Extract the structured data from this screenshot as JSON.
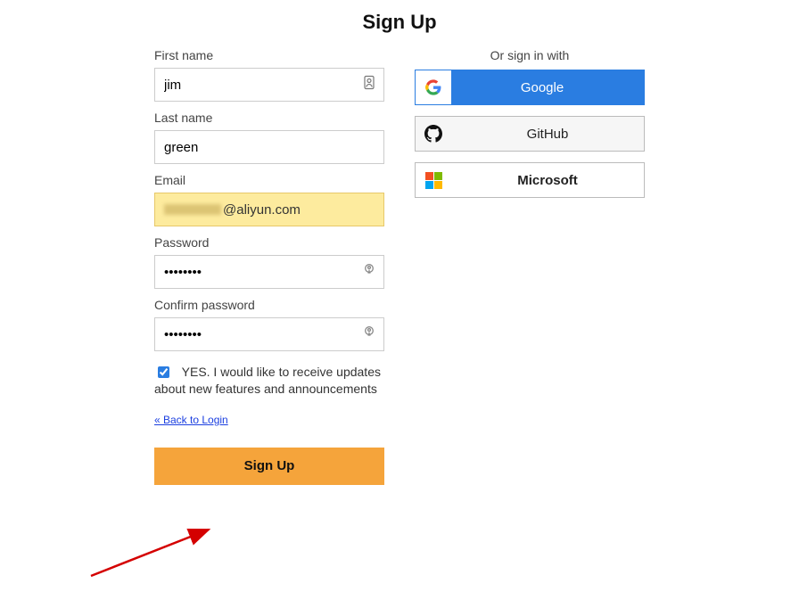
{
  "title": "Sign Up",
  "form": {
    "first_name": {
      "label": "First name",
      "value": "jim"
    },
    "last_name": {
      "label": "Last name",
      "value": "green"
    },
    "email": {
      "label": "Email",
      "value_suffix": "@aliyun.com"
    },
    "password": {
      "label": "Password",
      "value": "••••••••"
    },
    "confirm": {
      "label": "Confirm password",
      "value": "••••••••"
    },
    "updates": {
      "checked": true,
      "text": "YES. I would like to receive updates about new features and announcements"
    },
    "back_link": "« Back to Login",
    "submit": "Sign Up"
  },
  "sso": {
    "label": "Or sign in with",
    "google": "Google",
    "github": "GitHub",
    "microsoft": "Microsoft"
  }
}
